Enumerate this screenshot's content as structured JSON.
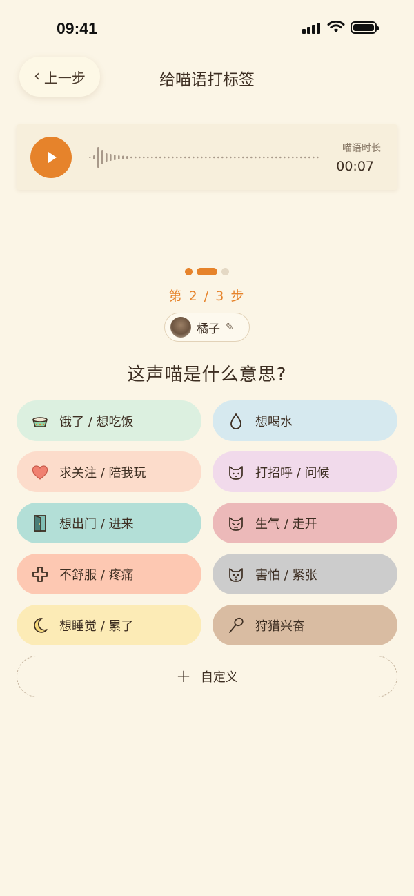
{
  "status_bar": {
    "time": "09:41"
  },
  "header": {
    "back_label": "上一步",
    "title": "给喵语打标签"
  },
  "audio": {
    "duration_label": "喵语时长",
    "duration_value": "00:07"
  },
  "progress": {
    "step_text": "第 2 / 3 步",
    "current_step": 2,
    "total_steps": 3
  },
  "cat": {
    "name": "橘子"
  },
  "question": "这声喵是什么意思?",
  "options": [
    {
      "label": "饿了 / 想吃饭",
      "icon": "food-bowl-icon",
      "color": "#dcf0e0"
    },
    {
      "label": "想喝水",
      "icon": "water-drop-icon",
      "color": "#d6e9ef"
    },
    {
      "label": "求关注 / 陪我玩",
      "icon": "heart-icon",
      "color": "#fcdccb"
    },
    {
      "label": "打招呼 / 问候",
      "icon": "cat-face-icon",
      "color": "#f1daeb"
    },
    {
      "label": "想出门 / 进来",
      "icon": "door-icon",
      "color": "#b3dfd7"
    },
    {
      "label": "生气 / 走开",
      "icon": "angry-cat-icon",
      "color": "#ecb9b9"
    },
    {
      "label": "不舒服 / 疼痛",
      "icon": "medical-cross-icon",
      "color": "#fdc8b2"
    },
    {
      "label": "害怕 / 紧张",
      "icon": "scared-cat-icon",
      "color": "#cccccc"
    },
    {
      "label": "想睡觉 / 累了",
      "icon": "moon-icon",
      "color": "#fcebb6"
    },
    {
      "label": "狩猎兴奋",
      "icon": "cat-toy-icon",
      "color": "#d9bca2"
    }
  ],
  "custom_label": "自定义",
  "colors": {
    "accent": "#e6832b",
    "background": "#fbf5e6"
  }
}
